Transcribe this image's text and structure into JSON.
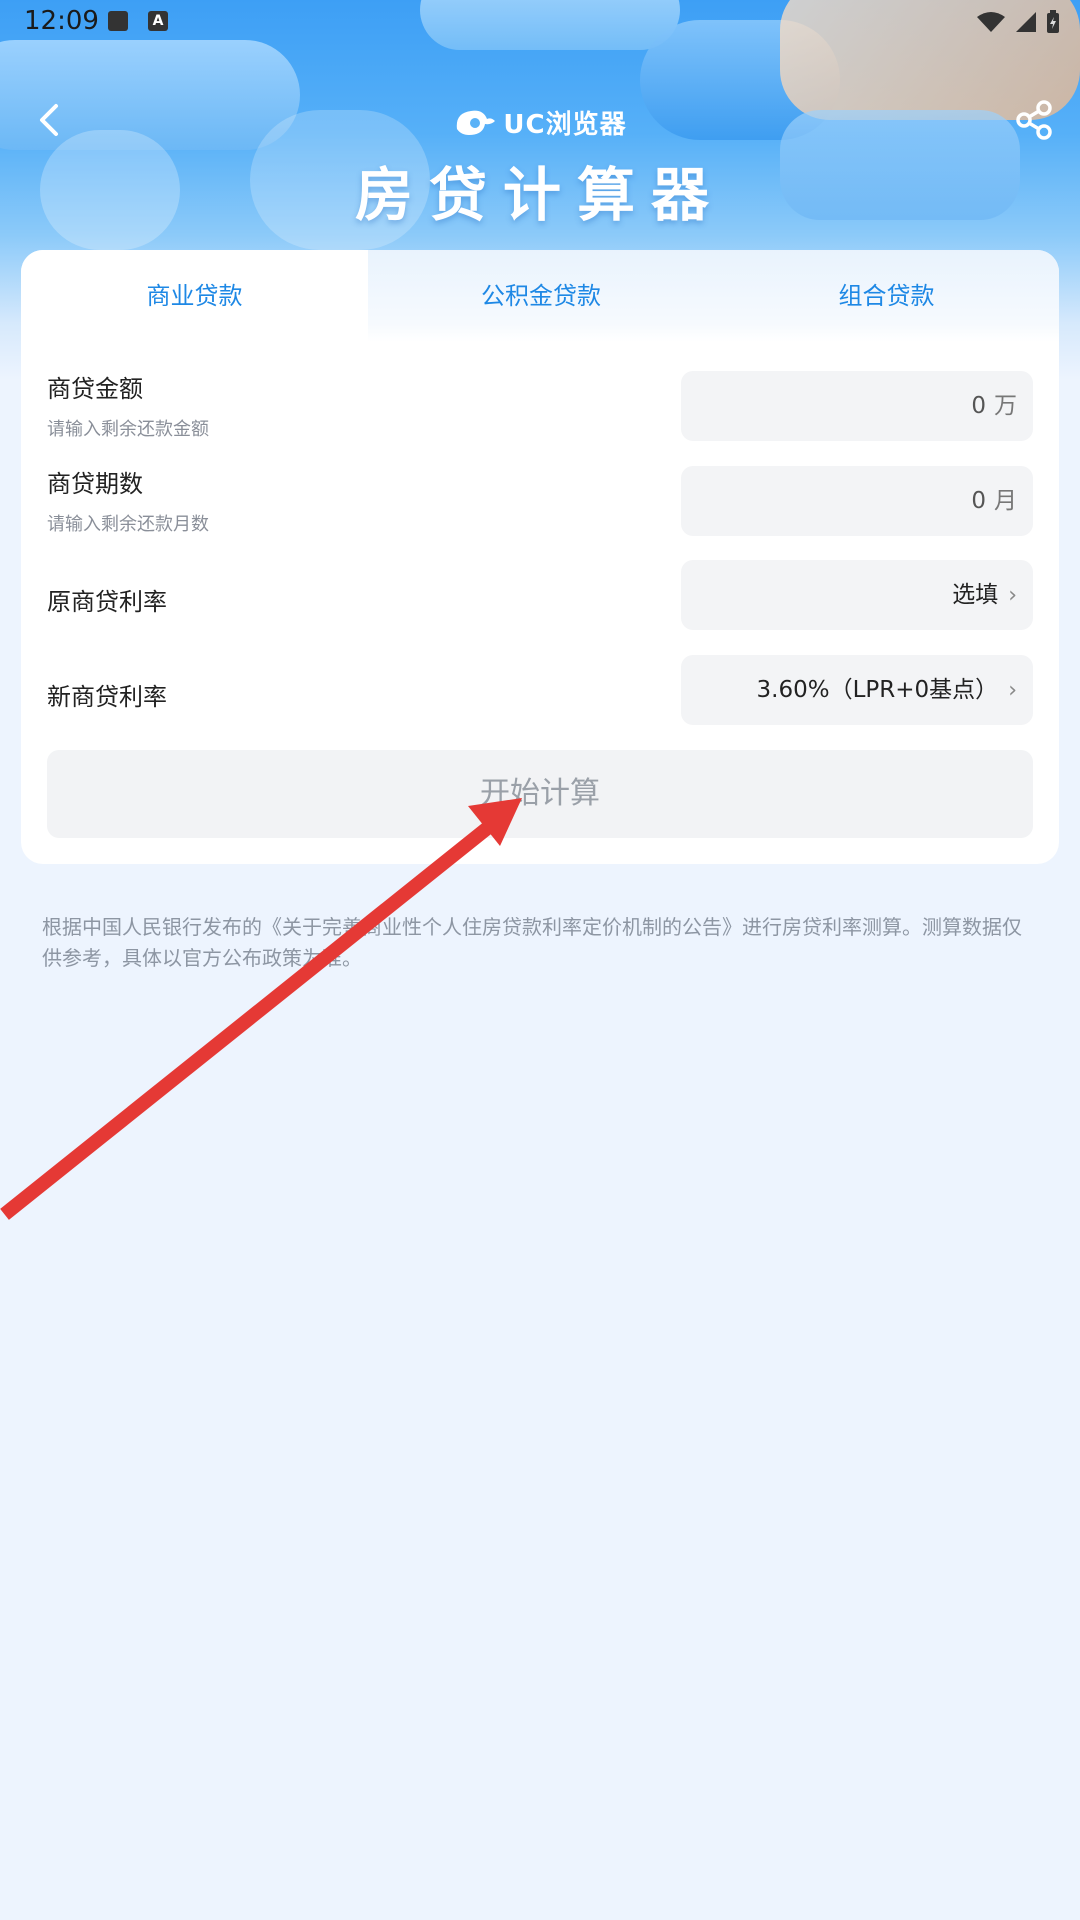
{
  "status_bar": {
    "time": "12:09"
  },
  "header": {
    "brand": "UC浏览器",
    "title": "房贷计算器"
  },
  "tabs": [
    {
      "label": "商业贷款",
      "active": true
    },
    {
      "label": "公积金贷款",
      "active": false
    },
    {
      "label": "组合贷款",
      "active": false
    }
  ],
  "form": {
    "amount": {
      "label": "商贷金额",
      "hint": "请输入剩余还款金额",
      "value": "0",
      "unit": "万"
    },
    "term": {
      "label": "商贷期数",
      "hint": "请输入剩余还款月数",
      "value": "0",
      "unit": "月"
    },
    "old_rate": {
      "label": "原商贷利率",
      "value": "选填"
    },
    "new_rate": {
      "label": "新商贷利率",
      "value": "3.60%（LPR+0基点）"
    }
  },
  "calc_button": "开始计算",
  "disclaimer": "根据中国人民银行发布的《关于完善商业性个人住房贷款利率定价机制的公告》进行房贷利率测算。测算数据仅供参考，具体以官方公布政策为准。",
  "colors": {
    "accent": "#1e88e5",
    "annotation_arrow": "#e53935"
  }
}
